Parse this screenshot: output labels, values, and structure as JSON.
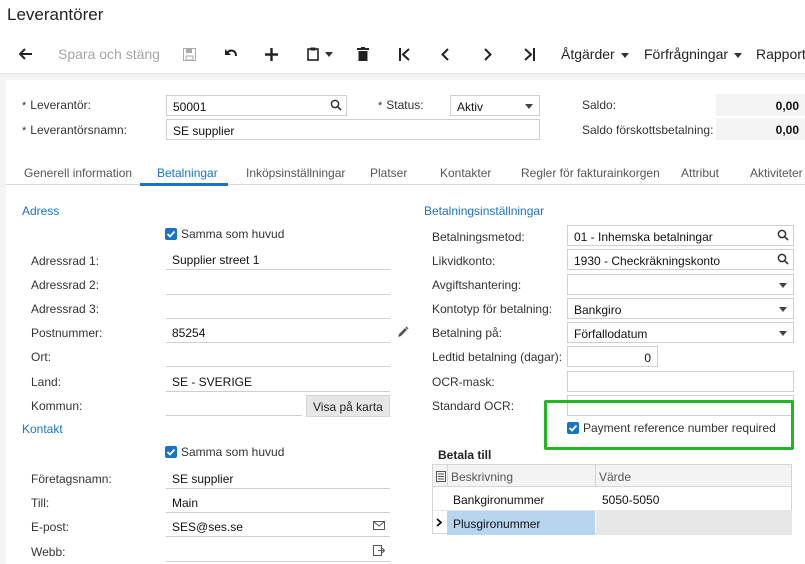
{
  "page": {
    "title": "Leverantörer"
  },
  "toolbar": {
    "save_close": "Spara och stäng",
    "actions": "Åtgärder",
    "inquiries": "Förfrågningar",
    "reports": "Rapporter"
  },
  "header": {
    "supplier_label": "Leverantör:",
    "supplier_value": "50001",
    "status_label": "Status:",
    "status_value": "Aktiv",
    "supplier_name_label": "Leverantörsnamn:",
    "supplier_name_value": "SE supplier",
    "balance_label": "Saldo:",
    "balance_value": "0,00",
    "prepayment_label": "Saldo förskottsbetalning:",
    "prepayment_value": "0,00"
  },
  "tabs": [
    {
      "label": "Generell information"
    },
    {
      "label": "Betalningar"
    },
    {
      "label": "Inköpsinställningar"
    },
    {
      "label": "Platser"
    },
    {
      "label": "Kontakter"
    },
    {
      "label": "Regler för fakturainkorgen"
    },
    {
      "label": "Attribut"
    },
    {
      "label": "Aktiviteter"
    }
  ],
  "address": {
    "section_title": "Adress",
    "same_as_main": "Samma som huvud",
    "line1_label": "Adressrad 1:",
    "line1_value": "Supplier street 1",
    "line2_label": "Adressrad 2:",
    "line3_label": "Adressrad 3:",
    "postal_label": "Postnummer:",
    "postal_value": "85254",
    "city_label": "Ort:",
    "country_label": "Land:",
    "country_value": "SE - SVERIGE",
    "municipality_label": "Kommun:",
    "map_button": "Visa på karta"
  },
  "contact": {
    "section_title": "Kontakt",
    "same_as_main": "Samma som huvud",
    "company_label": "Företagsnamn:",
    "company_value": "SE supplier",
    "attention_label": "Till:",
    "attention_value": "Main",
    "email_label": "E-post:",
    "email_value": "SES@ses.se",
    "web_label": "Webb:"
  },
  "payment": {
    "section_title": "Betalningsinställningar",
    "method_label": "Betalningsmetod:",
    "method_value": "01 - Inhemska betalningar",
    "cash_account_label": "Likvidkonto:",
    "cash_account_value": "1930 - Checkräkningskonto",
    "fee_label": "Avgiftshantering:",
    "account_type_label": "Kontotyp för betalning:",
    "account_type_value": "Bankgiro",
    "pay_on_label": "Betalning på:",
    "pay_on_value": "Förfallodatum",
    "lead_time_label": "Ledtid betalning (dagar):",
    "lead_time_value": "0",
    "ocr_mask_label": "OCR-mask:",
    "standard_ocr_label": "Standard OCR:",
    "ref_required_label": "Payment reference number required"
  },
  "pay_to": {
    "title": "Betala till",
    "col_description": "Beskrivning",
    "col_value": "Värde",
    "rows": [
      {
        "description": "Bankgironummer",
        "value": "5050-5050"
      },
      {
        "description": "Plusgironummer",
        "value": ""
      }
    ]
  },
  "colors": {
    "accent": "#1a73c6",
    "highlight": "#23b523",
    "selected_row": "#b7d5ef"
  }
}
